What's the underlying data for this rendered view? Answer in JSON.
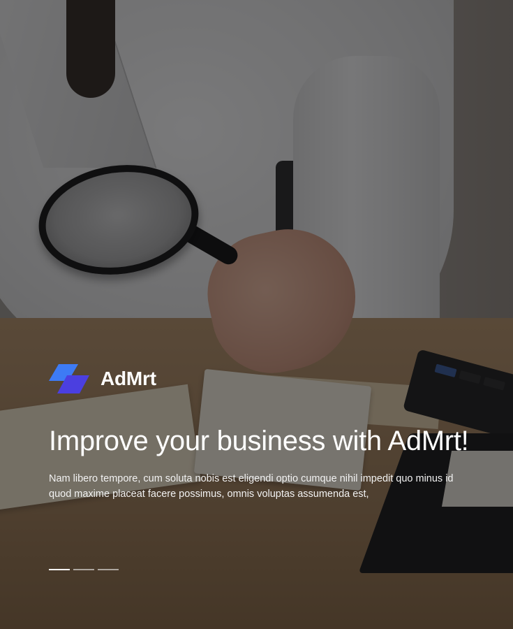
{
  "brand": {
    "name": "AdMrt",
    "logo_icon": "admrt-logo-icon",
    "logo_colors": [
      "#3d7bf5",
      "#4b3fe0"
    ]
  },
  "hero": {
    "headline": "Improve your business with AdMrt!",
    "description": "Nam libero tempore, cum soluta nobis est eligendi optio cumque nihil impedit quo minus id quod maxime placeat facere possimus, omnis voluptas assumenda est,",
    "background_image": "magnifying-glass-desk-photo"
  },
  "carousel": {
    "slides": 3,
    "active_index": 0
  }
}
